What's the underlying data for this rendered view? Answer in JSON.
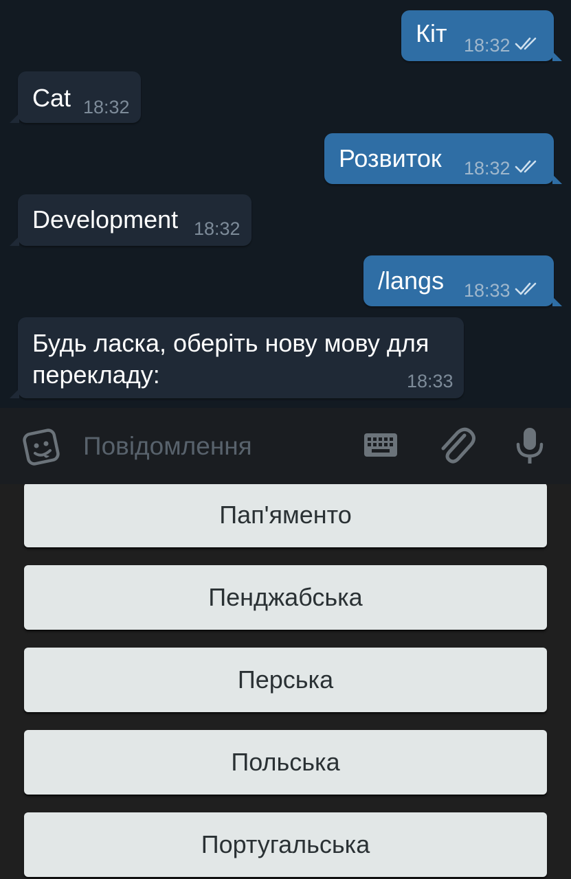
{
  "messages": [
    {
      "direction": "out",
      "text": "Кіт",
      "time": "18:32",
      "read": true
    },
    {
      "direction": "in",
      "text": "Cat",
      "time": "18:32"
    },
    {
      "direction": "out",
      "text": "Розвиток",
      "time": "18:32",
      "read": true
    },
    {
      "direction": "in",
      "text": "Development",
      "time": "18:32"
    },
    {
      "direction": "out",
      "text": "/langs",
      "time": "18:33",
      "read": true
    },
    {
      "direction": "in",
      "text_line1": "Будь ласка, оберіть нову мову для",
      "text_line2": "перекладу:",
      "time": "18:33"
    }
  ],
  "composer": {
    "placeholder": "Повідомлення",
    "icons": [
      "sticker-icon",
      "keyboard-icon",
      "attach-icon",
      "mic-icon"
    ]
  },
  "keyboard": {
    "buttons": [
      "Пап'яменто",
      "Пенджабська",
      "Перська",
      "Польська",
      "Португальська"
    ]
  },
  "colors": {
    "chat_background": "#121a22",
    "outgoing_bubble": "#2f6ea5",
    "incoming_bubble": "#1f2936",
    "composer_background": "#1a1d21",
    "keyboard_background": "#1f1f1f",
    "keyboard_button": "#e2e7e7"
  }
}
